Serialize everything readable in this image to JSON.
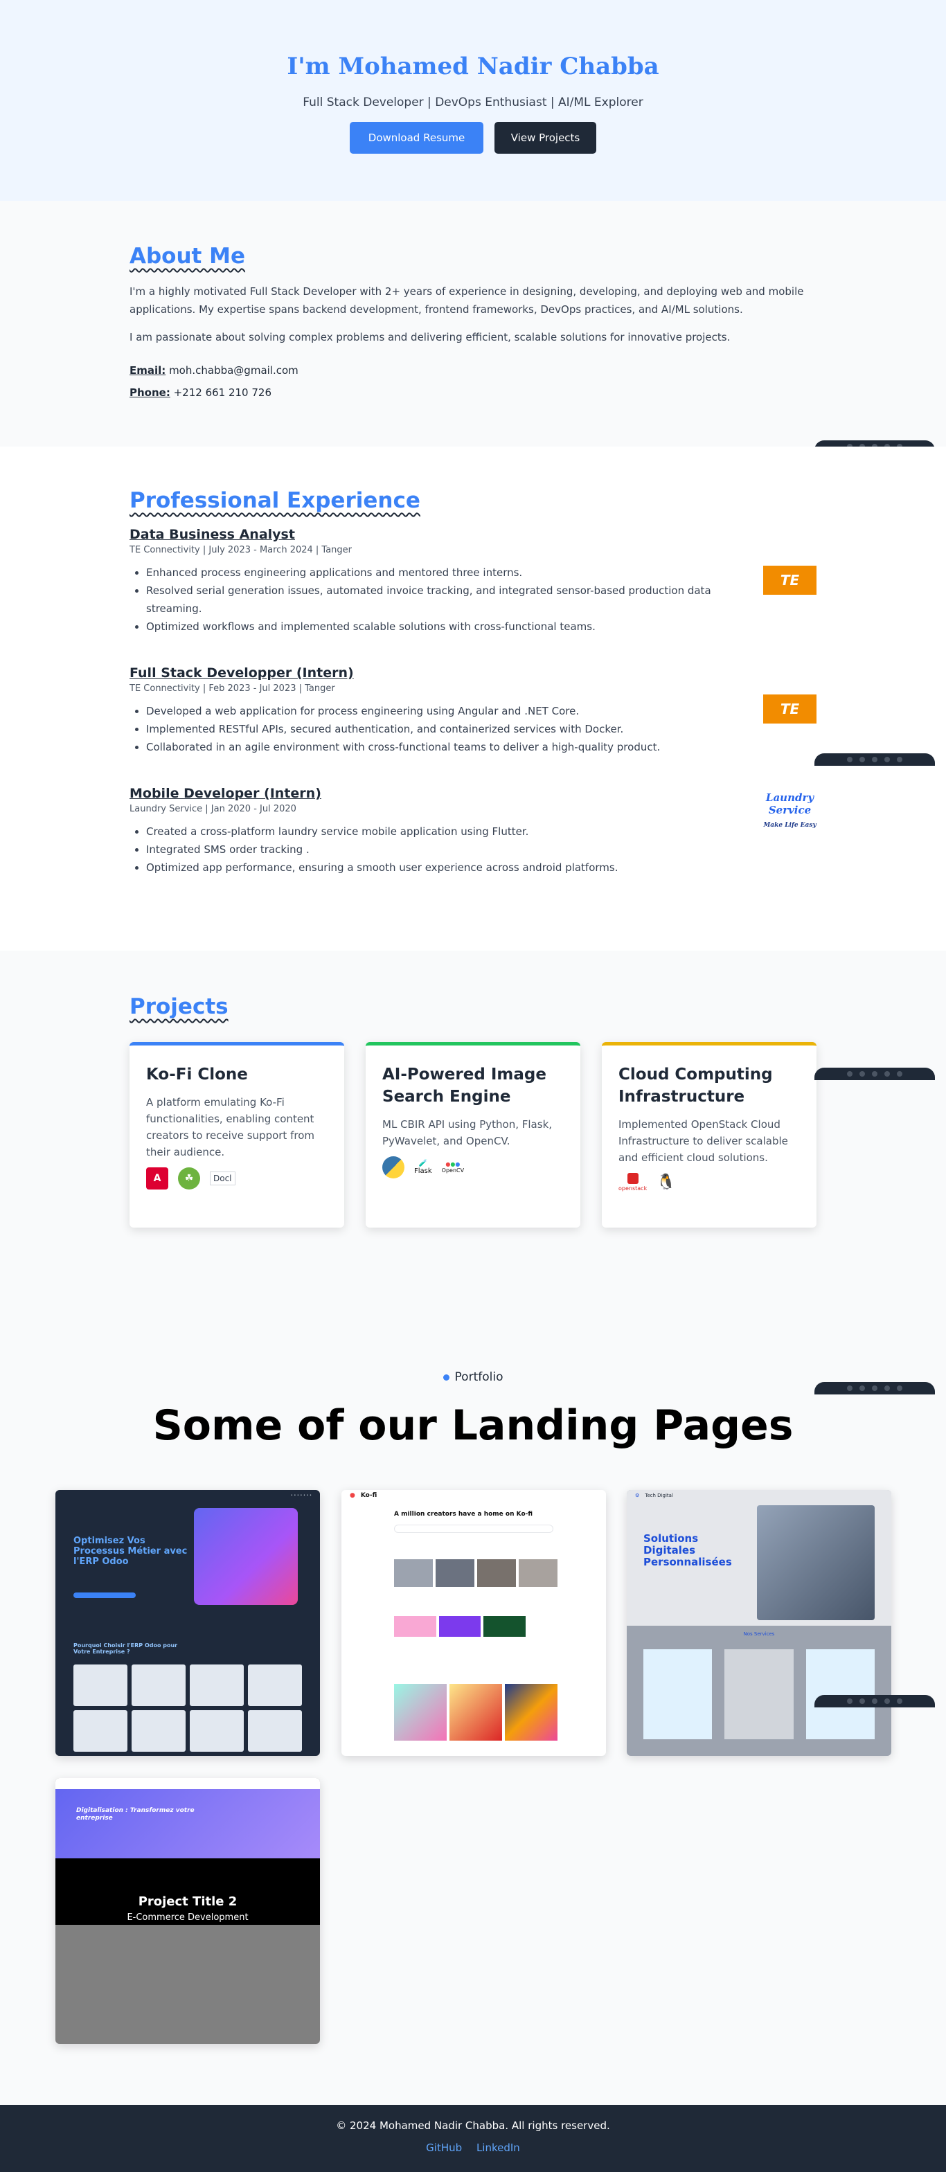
{
  "hero": {
    "name": "I'm Mohamed Nadir Chabba",
    "tagline": "Full Stack Developer | DevOps Enthusiast | AI/ML Explorer",
    "download_label": "Download Resume",
    "projects_label": "View Projects"
  },
  "about": {
    "title": "About Me",
    "para1": "I'm a highly motivated Full Stack Developer with 2+ years of experience in designing, developing, and deploying web and mobile applications. My expertise spans backend development, frontend frameworks, DevOps practices, and AI/ML solutions.",
    "para2": "I am passionate about solving complex problems and delivering efficient, scalable solutions for innovative projects.",
    "email_label": "Email:",
    "email": "moh.chabba@gmail.com",
    "phone_label": "Phone:",
    "phone": "+212 661 210 726"
  },
  "experience": {
    "title": "Professional Experience",
    "jobs": [
      {
        "role": "Data Business Analyst",
        "meta": "TE Connectivity | July 2023 - March 2024 | Tanger",
        "bullets": [
          "Enhanced process engineering applications and mentored three interns.",
          "Resolved serial generation issues, automated invoice tracking, and integrated sensor-based production data streaming.",
          "Optimized workflows and implemented scalable solutions with cross-functional teams."
        ],
        "logo": "TE"
      },
      {
        "role": "Full Stack Developper (Intern)",
        "meta": "TE Connectivity | Feb 2023 - Jul 2023 | Tanger",
        "bullets": [
          "Developed a web application for process engineering using Angular and .NET Core.",
          "Implemented RESTful APIs, secured authentication, and containerized services with Docker.",
          "Collaborated in an agile environment with cross-functional teams to deliver a high-quality product."
        ],
        "logo": "TE"
      },
      {
        "role": "Mobile Developer (Intern)",
        "meta": "Laundry Service | Jan 2020 - Jul 2020",
        "bullets": [
          "Created a cross-platform laundry service mobile application using Flutter.",
          "Integrated SMS order tracking .",
          "Optimized app performance, ensuring a smooth user experience across android platforms."
        ],
        "logo": "Laundry Service",
        "logo_sub": "Make Life Easy"
      }
    ]
  },
  "projects": {
    "title": "Projects",
    "cards": [
      {
        "title": "Ko-Fi Clone",
        "desc": "A platform emulating Ko-Fi functionalities, enabling content creators to receive support from their audience.",
        "accent": "#3b82f6",
        "icons": [
          "angular-icon",
          "spring-icon",
          "docker-icon"
        ],
        "broken_img_alt": "Docl"
      },
      {
        "title": "AI-Powered Image Search Engine",
        "desc": "ML CBIR API using Python, Flask, PyWavelet, and OpenCV.",
        "accent": "#22c55e",
        "icons": [
          "python-icon",
          "flask-icon",
          "opencv-icon"
        ],
        "flask_label": "Flask",
        "opencv_label": "OpenCV"
      },
      {
        "title": "Cloud Computing Infrastructure",
        "desc": "Implemented OpenStack Cloud Infrastructure to deliver scalable and efficient cloud solutions.",
        "accent": "#eab308",
        "icons": [
          "openstack-icon",
          "linux-icon"
        ],
        "openstack_label": "openstack"
      }
    ]
  },
  "portfolio": {
    "label": "Portfolio",
    "title": "Some of our Landing Pages",
    "shots": [
      {
        "name": "odoo-landing",
        "headline": "Optimisez Vos Processus Métier avec l'ERP Odoo",
        "sub": "Pourquoi Choisir l'ERP Odoo pour Votre Entreprise ?"
      },
      {
        "name": "kofi-landing",
        "brand": "Ko-fi",
        "headline": "A million creators have a home on Ko-fi"
      },
      {
        "name": "tech-digital-landing",
        "brand": "Tech Digital",
        "headline": "Solutions Digitales Personnalisées",
        "sub": "Nos Services"
      },
      {
        "name": "project-2",
        "headline": "Digitalisation : Transformez votre entreprise",
        "overlay_title": "Project Title 2",
        "overlay_sub": "E-Commerce Development"
      }
    ]
  },
  "footer": {
    "copy": "© 2024 Mohamed Nadir Chabba. All rights reserved.",
    "github": "GitHub",
    "linkedin": "LinkedIn"
  }
}
